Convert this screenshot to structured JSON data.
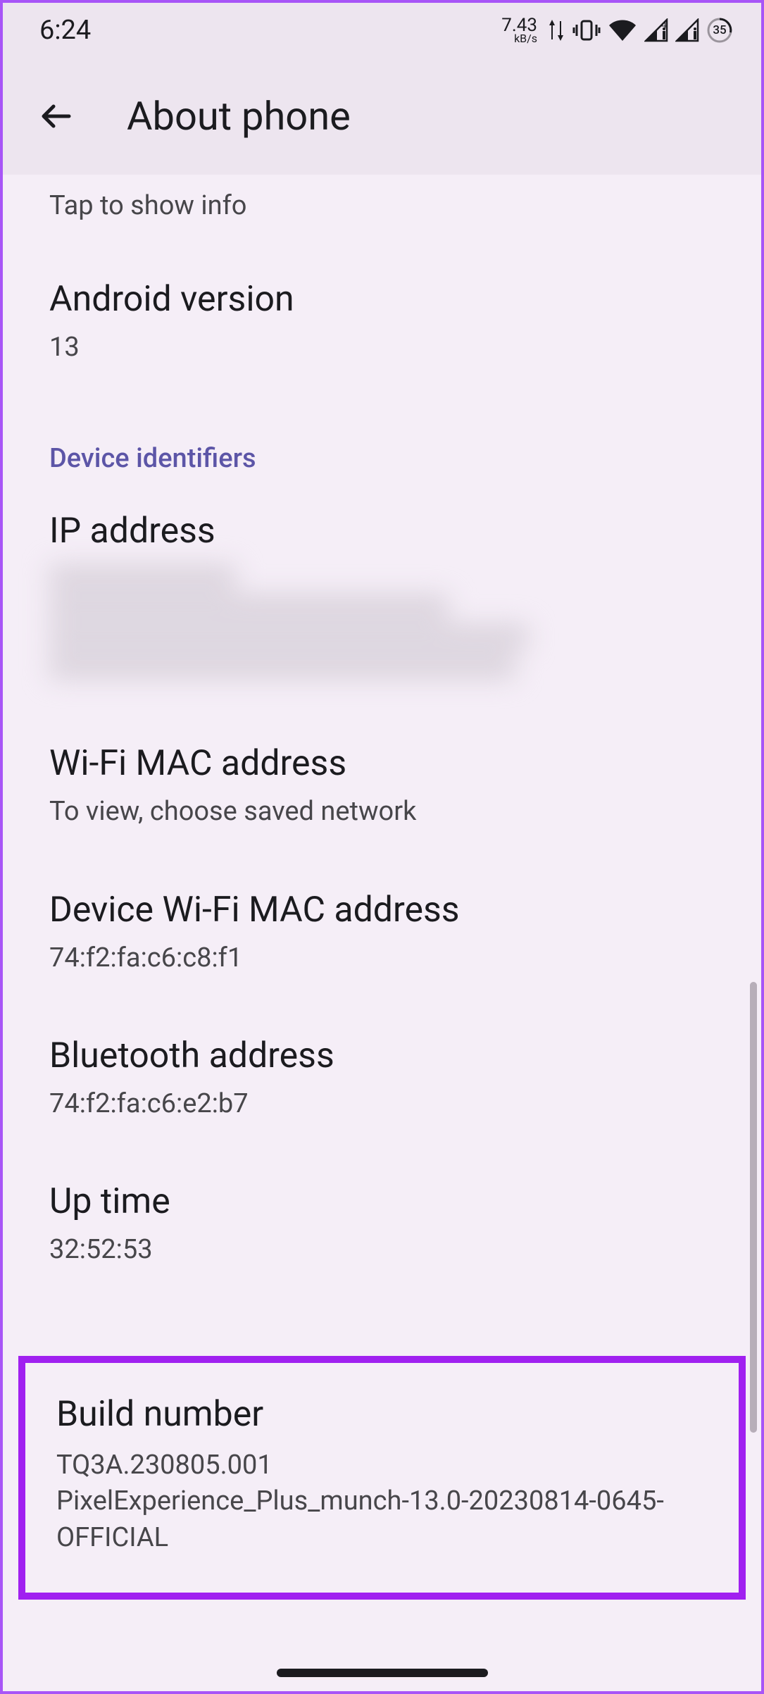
{
  "status": {
    "time": "6:24",
    "net_speed_value": "7.43",
    "net_speed_unit": "kB/s",
    "battery_pct": "35"
  },
  "header": {
    "title": "About phone"
  },
  "hint": "Tap to show info",
  "rows": {
    "android_version": {
      "title": "Android version",
      "value": "13"
    },
    "ip_address": {
      "title": "IP address"
    },
    "wifi_mac": {
      "title": "Wi-Fi MAC address",
      "value": "To view, choose saved network"
    },
    "device_wifi_mac": {
      "title": "Device Wi-Fi MAC address",
      "value": "74:f2:fa:c6:c8:f1"
    },
    "bluetooth": {
      "title": "Bluetooth address",
      "value": "74:f2:fa:c6:e2:b7"
    },
    "uptime": {
      "title": "Up time",
      "value": "32:52:53"
    },
    "build": {
      "title": "Build number",
      "line1": "TQ3A.230805.001",
      "line2": "PixelExperience_Plus_munch-13.0-20230814-0645-OFFICIAL"
    }
  },
  "section": {
    "device_identifiers": "Device identifiers"
  }
}
